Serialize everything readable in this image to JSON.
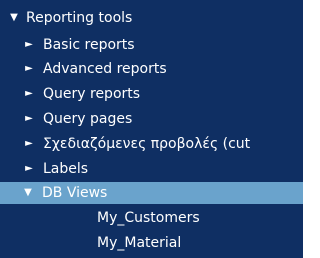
{
  "tree": {
    "root": {
      "label": "Reporting tools",
      "icon": "expanded-triangle-icon"
    },
    "children": [
      {
        "label": "Basic reports",
        "icon": "collapsed-triangle-icon"
      },
      {
        "label": "Advanced reports",
        "icon": "collapsed-triangle-icon"
      },
      {
        "label": "Query reports",
        "icon": "collapsed-triangle-icon"
      },
      {
        "label": "Query pages",
        "icon": "collapsed-triangle-icon"
      },
      {
        "label": "Σχεδιαζόμενες προβολές (cut",
        "icon": "collapsed-triangle-icon"
      },
      {
        "label": "Labels",
        "icon": "collapsed-triangle-icon"
      },
      {
        "label": "DB Views",
        "icon": "expanded-triangle-icon",
        "selected": true
      }
    ],
    "db_views": [
      {
        "label": "My_Customers"
      },
      {
        "label": "My_Material"
      }
    ]
  },
  "colors": {
    "panel_bg": "#0f2f63",
    "selected_bg": "#6aa3cc",
    "text": "#ffffff"
  }
}
